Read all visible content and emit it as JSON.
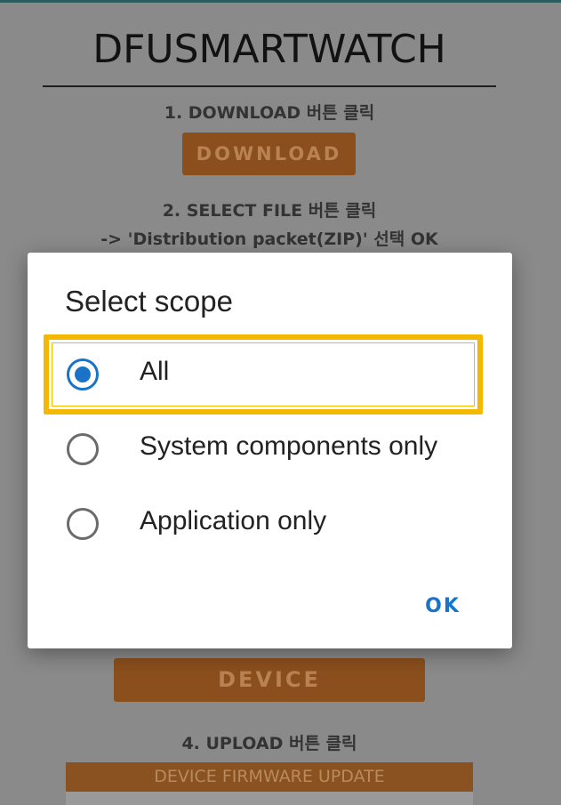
{
  "background": {
    "title": "DFUSMARTWATCH",
    "step1": "1. DOWNLOAD 버튼 클릭",
    "download_label": "DOWNLOAD",
    "step2_line1": "2. SELECT FILE 버튼 클릭",
    "step2_line2": "-> 'Distribution packet(ZIP)' 선택 OK",
    "device_label": "DEVICE",
    "step4": "4. UPLOAD 버튼 클릭",
    "firmware_update_label": "DEVICE FIRMWARE UPDATE"
  },
  "dialog": {
    "title": "Select scope",
    "options": [
      {
        "label": "All",
        "selected": true
      },
      {
        "label": "System components only",
        "selected": false
      },
      {
        "label": "Application only",
        "selected": false
      }
    ],
    "ok_label": "OK"
  },
  "colors": {
    "accent": "#1a73c8",
    "highlight": "#f4b800",
    "button_bg": "#8a4f1c"
  }
}
